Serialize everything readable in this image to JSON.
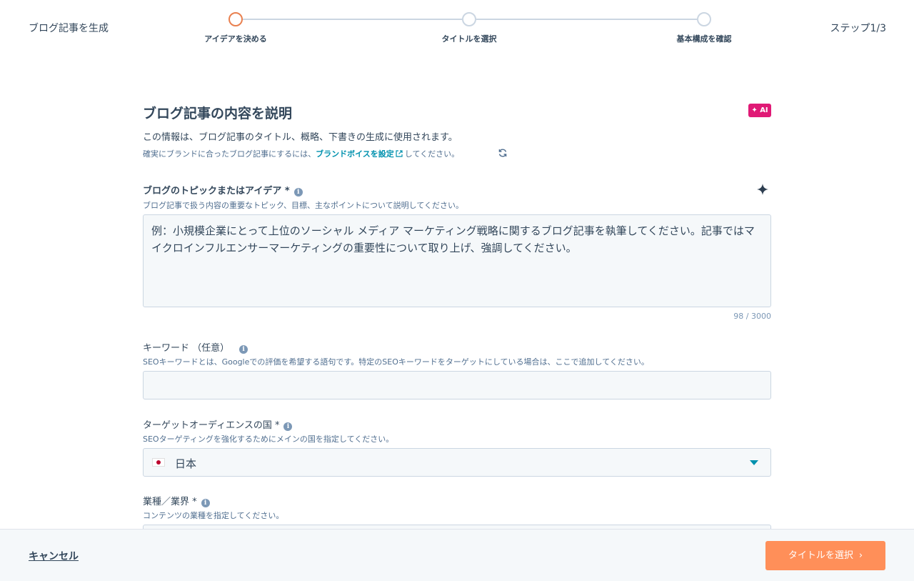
{
  "header": {
    "app_title": "ブログ記事を生成",
    "step_counter": "ステップ1/3",
    "steps": [
      {
        "label": "アイデアを決める",
        "active": true
      },
      {
        "label": "タイトルを選択",
        "active": false
      },
      {
        "label": "基本構成を確認",
        "active": false
      }
    ]
  },
  "section": {
    "title": "ブログ記事の内容を説明",
    "ai_badge": "✦ AI",
    "intro": "この情報は、ブログ記事のタイトル、概略、下書きの生成に使用されます。",
    "brand_prefix": "確実にブランドに合ったブログ記事にするには、",
    "brand_link": "ブランドボイスを設定",
    "brand_suffix": "してください。"
  },
  "topic_field": {
    "label": "ブログのトピックまたはアイデア *",
    "help": "ブログ記事で扱う内容の重要なトピック、目標、主なポイントについて説明してください。",
    "placeholder": "例：小規模企業にとって上位のソーシャル メディア マーケティング戦略に関するブログ記事を執筆してください。記事ではマイクロインフルエンサーマーケティングの重要性について取り上げ、強調してください。",
    "char_count": "98 / 3000"
  },
  "keyword_field": {
    "label": "キーワード （任意）",
    "help": "SEOキーワードとは、Googleでの評価を希望する語句です。特定のSEOキーワードをターゲットにしている場合は、ここで追加してください。",
    "value": ""
  },
  "country_field": {
    "label": "ターゲットオーディエンスの国 *",
    "help": "SEOターゲティングを強化するためにメインの国を指定してください。",
    "selected": "日本"
  },
  "industry_field": {
    "label": "業種／業界 *",
    "help": "コンテンツの業種を指定してください。"
  },
  "footer": {
    "cancel_label": "キャンセル",
    "next_label": "タイトルを選択"
  },
  "colors": {
    "accent_orange": "#ff8f59",
    "active_step": "#e9804f",
    "ai_badge": "#e01a76",
    "link": "#0091ae",
    "text": "#33475b"
  }
}
